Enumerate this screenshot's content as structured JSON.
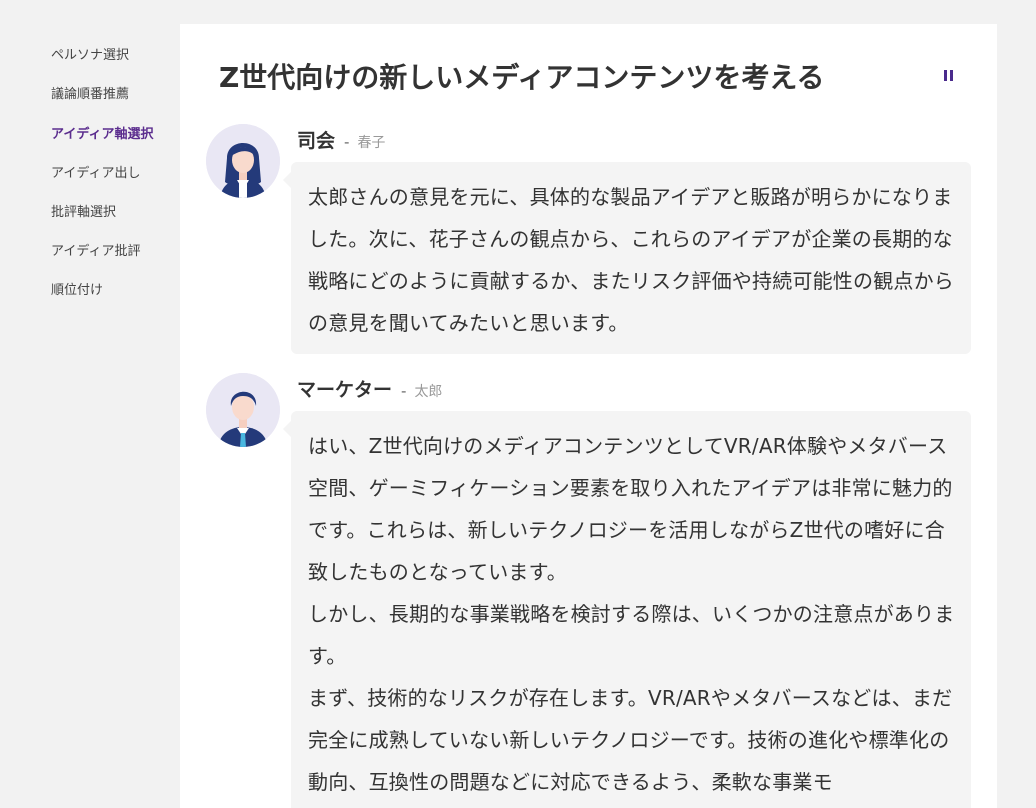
{
  "sidebar": {
    "items": [
      {
        "label": "ペルソナ選択"
      },
      {
        "label": "議論順番推薦"
      },
      {
        "label": "アイディア軸選択"
      },
      {
        "label": "アイディア出し"
      },
      {
        "label": "批評軸選択"
      },
      {
        "label": "アイディア批評"
      },
      {
        "label": "順位付け"
      }
    ],
    "active_index": 2
  },
  "main": {
    "title": "Z世代向けの新しいメディアコンテンツを考える",
    "messages": [
      {
        "role": "司会",
        "separator": "-",
        "name": "春子",
        "avatar_icon": "female-avatar-icon",
        "paragraphs": [
          "太郎さんの意見を元に、具体的な製品アイデアと販路が明らかになりました。次に、花子さんの観点から、これらのアイデアが企業の長期的な戦略にどのように貢献するか、またリスク評価や持続可能性の観点からの意見を聞いてみたいと思います。"
        ]
      },
      {
        "role": "マーケター",
        "separator": "-",
        "name": "太郎",
        "avatar_icon": "male-avatar-icon",
        "paragraphs": [
          "はい、Z世代向けのメディアコンテンツとしてVR/AR体験やメタバース空間、ゲーミフィケーション要素を取り入れたアイデアは非常に魅力的です。これらは、新しいテクノロジーを活用しながらZ世代の嗜好に合致したものとなっています。",
          "しかし、長期的な事業戦略を検討する際は、いくつかの注意点があります。",
          "まず、技術的なリスクが存在します。VR/ARやメタバースなどは、まだ完全に成熟していない新しいテクノロジーです。技術の進化や標準化の動向、互換性の問題などに対応できるよう、柔軟な事業モ"
        ]
      }
    ]
  },
  "colors": {
    "accent": "#5b2d8e",
    "background": "#f2f2f2",
    "card": "#ffffff",
    "bubble": "#f4f4f4",
    "avatar_bg": "#e9e7f4",
    "avatar_navy": "#243a7a"
  }
}
